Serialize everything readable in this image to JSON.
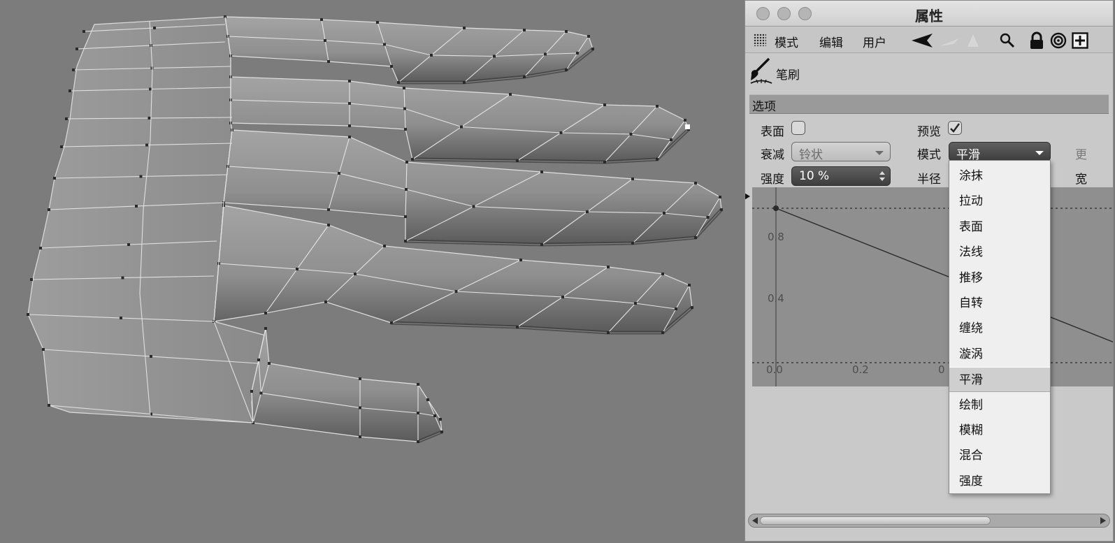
{
  "window": {
    "title": "属性"
  },
  "menubar": {
    "mode": "模式",
    "edit": "编辑",
    "user": "用户"
  },
  "tool": {
    "name": "笔刷"
  },
  "section": {
    "title": "选项"
  },
  "options": {
    "surface_label": "表面",
    "preview_label": "预览",
    "preview_checked": true,
    "falloff_label": "衰减",
    "falloff_value": "铃状",
    "mode_label": "模式",
    "mode_value": "平滑",
    "strength_label": "强度",
    "strength_value": "10 %",
    "radius_label": "半径",
    "more_label_1": "更",
    "more_label_2": "宽"
  },
  "graph": {
    "y_ticks": [
      "0.8",
      "0.4"
    ],
    "x_ticks": [
      "0.0",
      "0.2",
      "0"
    ]
  },
  "dropdown": {
    "options": [
      "涂抹",
      "拉动",
      "表面",
      "法线",
      "推移",
      "自转",
      "缠绕",
      "漩涡",
      "平滑",
      "绘制",
      "模糊",
      "混合",
      "强度"
    ],
    "selected": "平滑"
  }
}
